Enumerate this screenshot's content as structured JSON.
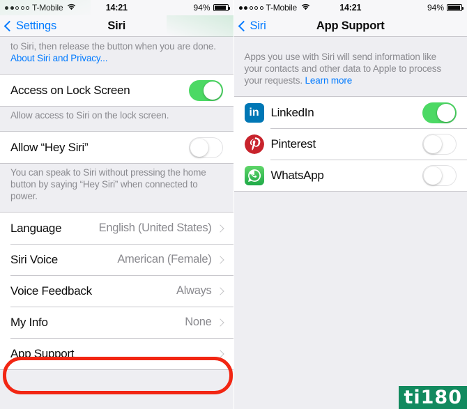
{
  "left": {
    "statusbar": {
      "signal_filled": 2,
      "signal_empty": 3,
      "carrier": "T-Mobile",
      "wifi_icon": "wifi-icon",
      "time": "14:21",
      "battery_percent": "94%"
    },
    "nav": {
      "back_label": "Settings",
      "title": "Siri"
    },
    "footnote_top": {
      "text": "to Siri, then release the button when you are done. ",
      "link": "About Siri and Privacy..."
    },
    "lock_screen_row": {
      "label": "Access on Lock Screen",
      "toggle": "on"
    },
    "lock_screen_footnote": "Allow access to Siri on the lock screen.",
    "hey_siri_row": {
      "label": "Allow “Hey Siri”",
      "toggle": "off"
    },
    "hey_siri_footnote": "You can speak to Siri without pressing the home button by saying “Hey Siri” when connected to power.",
    "settings_rows": [
      {
        "label": "Language",
        "value": "English (United States)",
        "accessory": "chevron-right-icon"
      },
      {
        "label": "Siri Voice",
        "value": "American (Female)",
        "accessory": "chevron-right-icon"
      },
      {
        "label": "Voice Feedback",
        "value": "Always",
        "accessory": "chevron-right-icon"
      },
      {
        "label": "My Info",
        "value": "None",
        "accessory": "chevron-right-icon"
      },
      {
        "label": "App Support",
        "value": "",
        "accessory": "chevron-right-icon"
      }
    ],
    "annotation": {
      "target": "App Support",
      "color": "#f22613"
    }
  },
  "right": {
    "statusbar": {
      "signal_filled": 2,
      "signal_empty": 3,
      "carrier": "T-Mobile",
      "wifi_icon": "wifi-icon",
      "time": "14:21",
      "battery_percent": "94%"
    },
    "nav": {
      "back_label": "Siri",
      "title": "App Support"
    },
    "description": {
      "text": "Apps you use with Siri will send information like your contacts and other data to Apple to process your requests. ",
      "link": "Learn more"
    },
    "apps": [
      {
        "name": "LinkedIn",
        "icon": "linkedin-icon",
        "icon_text": "in",
        "toggle": "on"
      },
      {
        "name": "Pinterest",
        "icon": "pinterest-icon",
        "icon_text": "",
        "toggle": "off"
      },
      {
        "name": "WhatsApp",
        "icon": "whatsapp-icon",
        "icon_text": "",
        "toggle": "off"
      }
    ]
  },
  "watermark": {
    "text": "ti180",
    "bg": "#128a5f"
  }
}
